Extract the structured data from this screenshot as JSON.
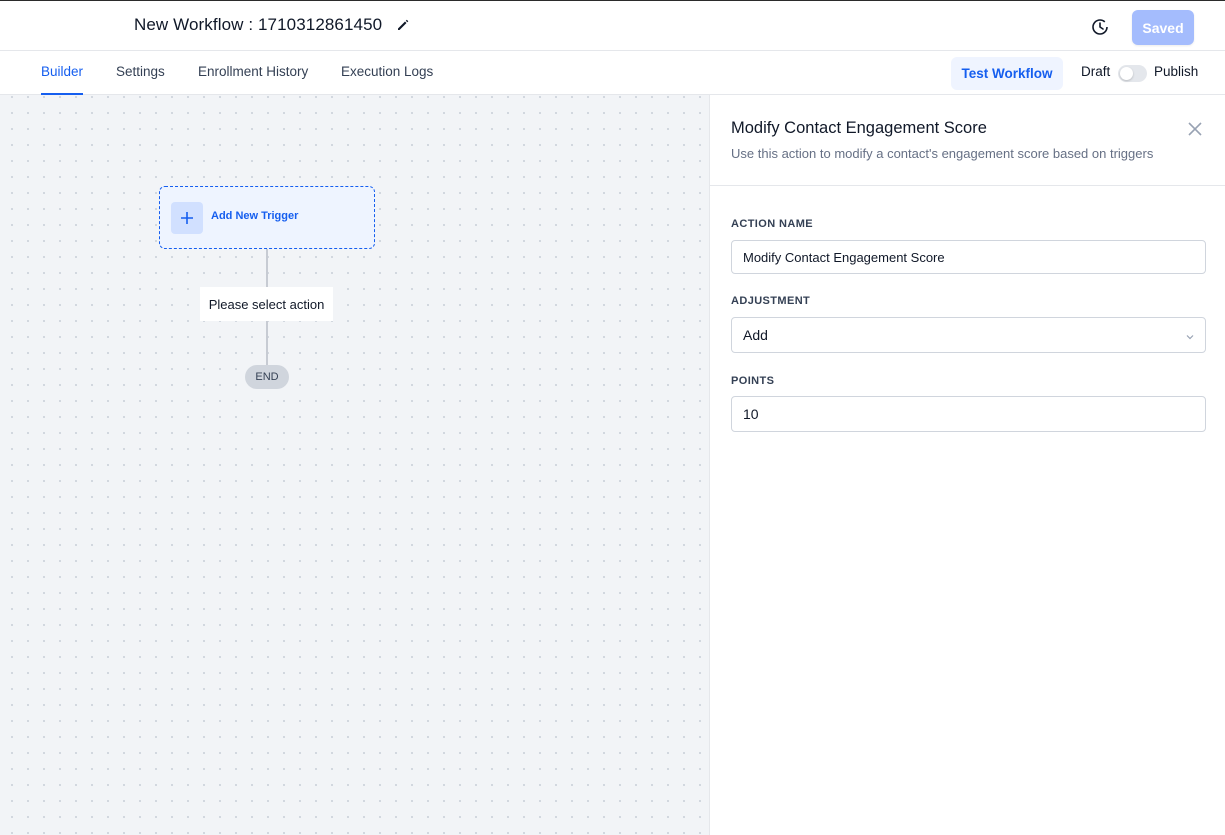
{
  "header": {
    "title": "New Workflow : 1710312861450",
    "saved_label": "Saved"
  },
  "tabs": [
    {
      "label": "Builder",
      "active": true
    },
    {
      "label": "Settings",
      "active": false
    },
    {
      "label": "Enrollment History",
      "active": false
    },
    {
      "label": "Execution Logs",
      "active": false
    }
  ],
  "toolbar": {
    "test_label": "Test Workflow",
    "draft_label": "Draft",
    "publish_label": "Publish",
    "published": false
  },
  "canvas": {
    "trigger_label": "Add New Trigger",
    "select_action_label": "Please select action",
    "end_label": "END"
  },
  "panel": {
    "title": "Modify Contact Engagement Score",
    "description": "Use this action to modify a contact's engagement score based on triggers",
    "action_name_label": "ACTION NAME",
    "action_name_value": "Modify Contact Engagement Score",
    "adjustment_label": "ADJUSTMENT",
    "adjustment_value": "Add",
    "points_label": "POINTS",
    "points_value": "10"
  },
  "icons": {
    "edit": "pencil-icon",
    "history": "clock-history-icon",
    "add": "plus-icon",
    "close": "close-icon",
    "dropdown": "chevron-down-icon"
  },
  "colors": {
    "accent": "#155eef",
    "saved_button": "#a4bcfd",
    "canvas_bg": "#f2f4f7"
  }
}
